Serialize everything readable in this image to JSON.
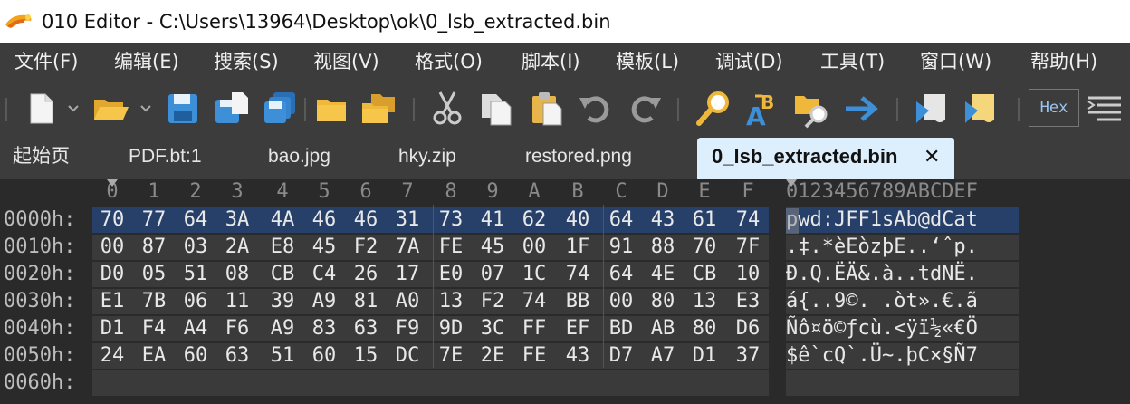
{
  "window": {
    "title": "010 Editor - C:\\Users\\13964\\Desktop\\ok\\0_lsb_extracted.bin"
  },
  "menu": [
    {
      "label": "文件(F)"
    },
    {
      "label": "编辑(E)"
    },
    {
      "label": "搜索(S)"
    },
    {
      "label": "视图(V)"
    },
    {
      "label": "格式(O)"
    },
    {
      "label": "脚本(I)"
    },
    {
      "label": "模板(L)"
    },
    {
      "label": "调试(D)"
    },
    {
      "label": "工具(T)"
    },
    {
      "label": "窗口(W)"
    },
    {
      "label": "帮助(H)"
    }
  ],
  "toolbar": {
    "buttons": [
      "new-file-icon",
      "open-file-icon",
      "save-icon",
      "save-as-icon",
      "save-all-icon",
      "open-folder-icon",
      "open-workspace-icon",
      "cut-icon",
      "copy-icon",
      "paste-icon",
      "undo-icon",
      "redo-icon",
      "find-icon",
      "replace-icon",
      "find-in-files-icon",
      "goto-icon",
      "run-script-icon",
      "run-template-icon",
      "hex-mode-icon",
      "text-mode-icon"
    ],
    "hex_label": "Hex"
  },
  "tabs": [
    {
      "label": "起始页"
    },
    {
      "label": "PDF.bt:1"
    },
    {
      "label": "bao.jpg"
    },
    {
      "label": "hky.zip"
    },
    {
      "label": "restored.png"
    },
    {
      "label": "0_lsb_extracted.bin",
      "active": true
    }
  ],
  "hex": {
    "column_headers": [
      "0",
      "1",
      "2",
      "3",
      "4",
      "5",
      "6",
      "7",
      "8",
      "9",
      "A",
      "B",
      "C",
      "D",
      "E",
      "F"
    ],
    "text_header": "0123456789ABCDEF",
    "rows": [
      {
        "address": "0000h:",
        "bytes": [
          "70",
          "77",
          "64",
          "3A",
          "4A",
          "46",
          "46",
          "31",
          "73",
          "41",
          "62",
          "40",
          "64",
          "43",
          "61",
          "74"
        ],
        "text": "pwd:JFF1sAb@dCat"
      },
      {
        "address": "0010h:",
        "bytes": [
          "00",
          "87",
          "03",
          "2A",
          "E8",
          "45",
          "F2",
          "7A",
          "FE",
          "45",
          "00",
          "1F",
          "91",
          "88",
          "70",
          "7F"
        ],
        "text": ".‡.*èEòzþE..‘ˆp."
      },
      {
        "address": "0020h:",
        "bytes": [
          "D0",
          "05",
          "51",
          "08",
          "CB",
          "C4",
          "26",
          "17",
          "E0",
          "07",
          "1C",
          "74",
          "64",
          "4E",
          "CB",
          "10"
        ],
        "text": "Ð.Q.ËÄ&.à..tdNË."
      },
      {
        "address": "0030h:",
        "bytes": [
          "E1",
          "7B",
          "06",
          "11",
          "39",
          "A9",
          "81",
          "A0",
          "13",
          "F2",
          "74",
          "BB",
          "00",
          "80",
          "13",
          "E3"
        ],
        "text": "á{..9©. .òt».€.ã"
      },
      {
        "address": "0040h:",
        "bytes": [
          "D1",
          "F4",
          "A4",
          "F6",
          "A9",
          "83",
          "63",
          "F9",
          "9D",
          "3C",
          "FF",
          "EF",
          "BD",
          "AB",
          "80",
          "D6"
        ],
        "text": "Ñô¤ö©ƒcù.<ÿï½«€Ö"
      },
      {
        "address": "0050h:",
        "bytes": [
          "24",
          "EA",
          "60",
          "63",
          "51",
          "60",
          "15",
          "DC",
          "7E",
          "2E",
          "FE",
          "43",
          "D7",
          "A7",
          "D1",
          "37"
        ],
        "text": "$ê`cQ`.Ü~.þC×§Ñ7"
      },
      {
        "address": "0060h:",
        "bytes": [],
        "text": ""
      }
    ]
  }
}
